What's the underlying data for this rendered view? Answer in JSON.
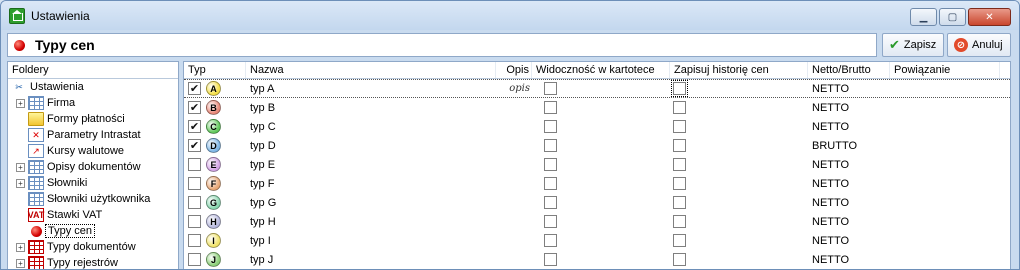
{
  "window": {
    "title": "Ustawienia"
  },
  "header": {
    "title": "Typy cen",
    "save_label": "Zapisz",
    "cancel_label": "Anuluj"
  },
  "sidebar": {
    "title": "Foldery",
    "items": [
      {
        "label": "Ustawienia"
      },
      {
        "label": "Firma"
      },
      {
        "label": "Formy płatności"
      },
      {
        "label": "Parametry Intrastat"
      },
      {
        "label": "Kursy walutowe"
      },
      {
        "label": "Opisy dokumentów"
      },
      {
        "label": "Słowniki"
      },
      {
        "label": "Słowniki użytkownika"
      },
      {
        "label": "Stawki VAT"
      },
      {
        "label": "Typy cen"
      },
      {
        "label": "Typy dokumentów"
      },
      {
        "label": "Typy rejestrów"
      }
    ]
  },
  "grid": {
    "columns": {
      "typ": "Typ",
      "nazwa": "Nazwa",
      "opis": "Opis",
      "widocznosc": "Widoczność w kartotece",
      "historia": "Zapisuj historię cen",
      "netto_brutto": "Netto/Brutto",
      "powiazanie": "Powiązanie"
    },
    "rows": [
      {
        "checked": "✔",
        "letter": "A",
        "color": "#f4e04a",
        "name": "typ A",
        "opis": "opis",
        "mode": "NETTO"
      },
      {
        "checked": "✔",
        "letter": "B",
        "color": "#e98a7a",
        "name": "typ B",
        "opis": "",
        "mode": "NETTO"
      },
      {
        "checked": "✔",
        "letter": "C",
        "color": "#62c95c",
        "name": "typ C",
        "opis": "",
        "mode": "NETTO"
      },
      {
        "checked": "✔",
        "letter": "D",
        "color": "#7fb6e6",
        "name": "typ D",
        "opis": "",
        "mode": "BRUTTO"
      },
      {
        "checked": "",
        "letter": "E",
        "color": "#d4a5e6",
        "name": "typ E",
        "opis": "",
        "mode": "NETTO"
      },
      {
        "checked": "",
        "letter": "F",
        "color": "#e8a877",
        "name": "typ F",
        "opis": "",
        "mode": "NETTO"
      },
      {
        "checked": "",
        "letter": "G",
        "color": "#8ad7b0",
        "name": "typ G",
        "opis": "",
        "mode": "NETTO"
      },
      {
        "checked": "",
        "letter": "H",
        "color": "#b7b9df",
        "name": "typ H",
        "opis": "",
        "mode": "NETTO"
      },
      {
        "checked": "",
        "letter": "I",
        "color": "#f1e36a",
        "name": "typ I",
        "opis": "",
        "mode": "NETTO"
      },
      {
        "checked": "",
        "letter": "J",
        "color": "#8ed07a",
        "name": "typ J",
        "opis": "",
        "mode": "NETTO"
      }
    ]
  }
}
